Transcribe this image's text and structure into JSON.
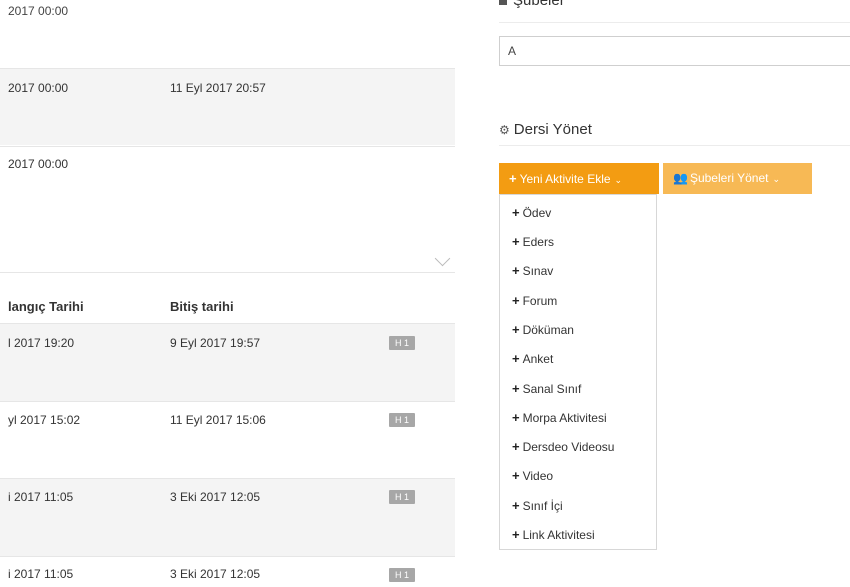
{
  "top_list": {
    "rows": [
      {
        "start": "2017 00:00"
      },
      {
        "start": "2017 00:00",
        "end": "11 Eyl 2017 20:57"
      },
      {
        "start": "2017 00:00"
      }
    ]
  },
  "table": {
    "headers": {
      "start": "langıç Tarihi",
      "end": "Bitiş tarihi"
    },
    "rows": [
      {
        "start": "l 2017 19:20",
        "end": "9 Eyl 2017 19:57",
        "badge": "H 1"
      },
      {
        "start": "yl 2017 15:02",
        "end": "11 Eyl 2017 15:06",
        "badge": "H 1"
      },
      {
        "start": "i 2017 11:05",
        "end": "3 Eki 2017 12:05",
        "badge": "H 1"
      },
      {
        "start": "i 2017 11:05",
        "end": "3 Eki 2017 12:05",
        "badge": "H 1"
      }
    ]
  },
  "subeler": {
    "title": "Şubeler",
    "input_value": "A"
  },
  "dersi_yonet": {
    "title": "Dersi Yönet",
    "add_activity_label": "Yeni Aktivite Ekle",
    "manage_branches_label": "Şubeleri Yönet",
    "menu_items": [
      "Ödev",
      "Eders",
      "Sınav",
      "Forum",
      "Döküman",
      "Anket",
      "Sanal Sınıf",
      "Morpa Aktivitesi",
      "Dersdeo Videosu",
      "Video",
      "Sınıf İçi",
      "Link Aktivitesi"
    ]
  },
  "colors": {
    "primary_button": "#f39c12",
    "secondary_button": "#f7b955",
    "badge": "#a7a7a7"
  }
}
